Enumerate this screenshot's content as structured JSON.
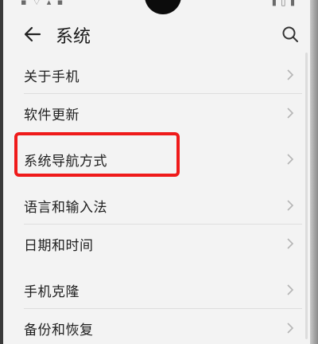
{
  "header": {
    "title": "系统",
    "back_icon": "back-arrow-icon",
    "search_icon": "search-icon"
  },
  "list": {
    "items": [
      {
        "label": "关于手机"
      },
      {
        "label": "软件更新"
      },
      {
        "label": "系统导航方式"
      },
      {
        "label": "语言和输入法"
      },
      {
        "label": "日期和时间"
      },
      {
        "label": "手机克隆"
      },
      {
        "label": "备份和恢复"
      }
    ]
  },
  "annotation": {
    "highlight_color": "#ef1a1a"
  }
}
